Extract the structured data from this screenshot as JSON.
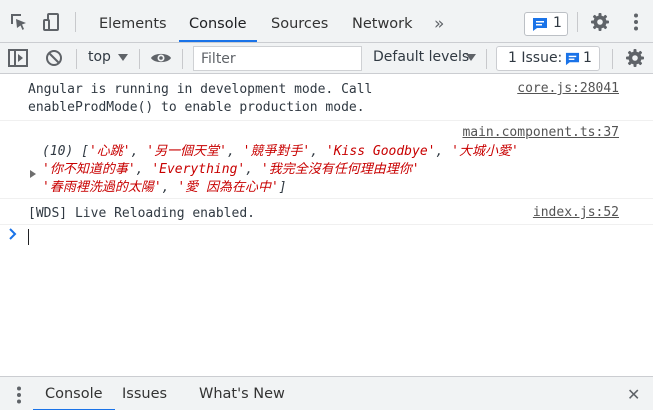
{
  "tabs": [
    {
      "label": "Elements"
    },
    {
      "label": "Console"
    },
    {
      "label": "Sources"
    },
    {
      "label": "Network"
    }
  ],
  "more_tabs_glyph": "»",
  "messages_badge": {
    "count": "1"
  },
  "toolbar": {
    "context": "top",
    "filter_placeholder": "Filter",
    "levels": "Default levels",
    "issues_label": "1 Issue:",
    "issues_count": "1"
  },
  "console": {
    "msg1": {
      "line1": "Angular is running in development mode. Call",
      "line2": "enableProdMode() to enable production mode.",
      "source": "core.js:28041"
    },
    "msg2": {
      "source": "main.component.ts:37",
      "prefix": "(10) [",
      "items": [
        "'心跳'",
        "'另一個天堂'",
        "'競爭對手'",
        "'Kiss Goodbye'",
        "'大城小愛'",
        "'你不知道的事'",
        "'Everything'",
        "'我完全沒有任何理由理你'",
        "'春雨裡洗過的太陽'",
        "'愛 因為在心中'"
      ],
      "sep": ", ",
      "suffix": "]"
    },
    "msg3": {
      "text": "[WDS] Live Reloading enabled.",
      "source": "index.js:52"
    }
  },
  "drawer": {
    "tabs": [
      {
        "label": "Console"
      },
      {
        "label": "Issues"
      },
      {
        "label": "What's New"
      }
    ],
    "close_glyph": "✕"
  },
  "colors": {
    "accent": "#1a73e8",
    "string": "#c80000",
    "toolbar_bg": "#f1f3f4"
  }
}
